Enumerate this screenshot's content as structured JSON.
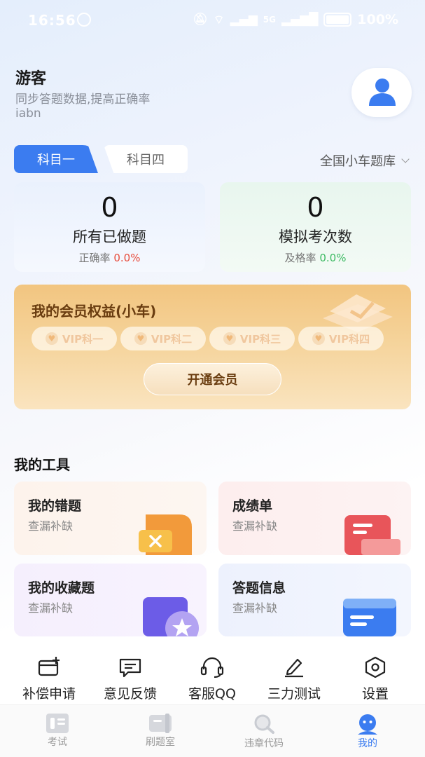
{
  "status_bar": {
    "time": "16:56",
    "signal_label": "5G",
    "battery": "100%"
  },
  "profile": {
    "name": "游客",
    "subtitle": "同步答题数据,提高正确率",
    "user_id": "iabn"
  },
  "subject_tabs": [
    {
      "label": "科目一",
      "active": true
    },
    {
      "label": "科目四",
      "active": false
    }
  ],
  "question_bank": {
    "label": "全国小车题库"
  },
  "stats": [
    {
      "value": "0",
      "label": "所有已做题",
      "rate_label": "正确率",
      "rate_value": "0.0%",
      "rate_color": "#e74c3c"
    },
    {
      "value": "0",
      "label": "模拟考次数",
      "rate_label": "及格率",
      "rate_value": "0.0%",
      "rate_color": "#3cba62"
    }
  ],
  "vip": {
    "title": "我的会员权益(小车)",
    "chips": [
      "VIP科一",
      "VIP科二",
      "VIP科三",
      "VIP科四"
    ],
    "button": "开通会员"
  },
  "tools": {
    "section_title": "我的工具",
    "items": [
      {
        "title": "我的错题",
        "subtitle": "查漏补缺"
      },
      {
        "title": "成绩单",
        "subtitle": "查漏补缺"
      },
      {
        "title": "我的收藏题",
        "subtitle": "查漏补缺"
      },
      {
        "title": "答题信息",
        "subtitle": "查漏补缺"
      }
    ]
  },
  "quick_actions": [
    {
      "label": "补偿申请",
      "icon": "card-plus-icon"
    },
    {
      "label": "意见反馈",
      "icon": "feedback-icon"
    },
    {
      "label": "客服QQ",
      "icon": "headset-icon"
    },
    {
      "label": "三力测试",
      "icon": "pen-test-icon"
    },
    {
      "label": "设置",
      "icon": "settings-hex-icon"
    }
  ],
  "tab_bar": [
    {
      "label": "考试",
      "active": false
    },
    {
      "label": "刷题室",
      "active": false
    },
    {
      "label": "违章代码",
      "active": false
    },
    {
      "label": "我的",
      "active": true
    }
  ],
  "colors": {
    "accent": "#3b7cf0",
    "vip_text": "#6a3d10"
  }
}
